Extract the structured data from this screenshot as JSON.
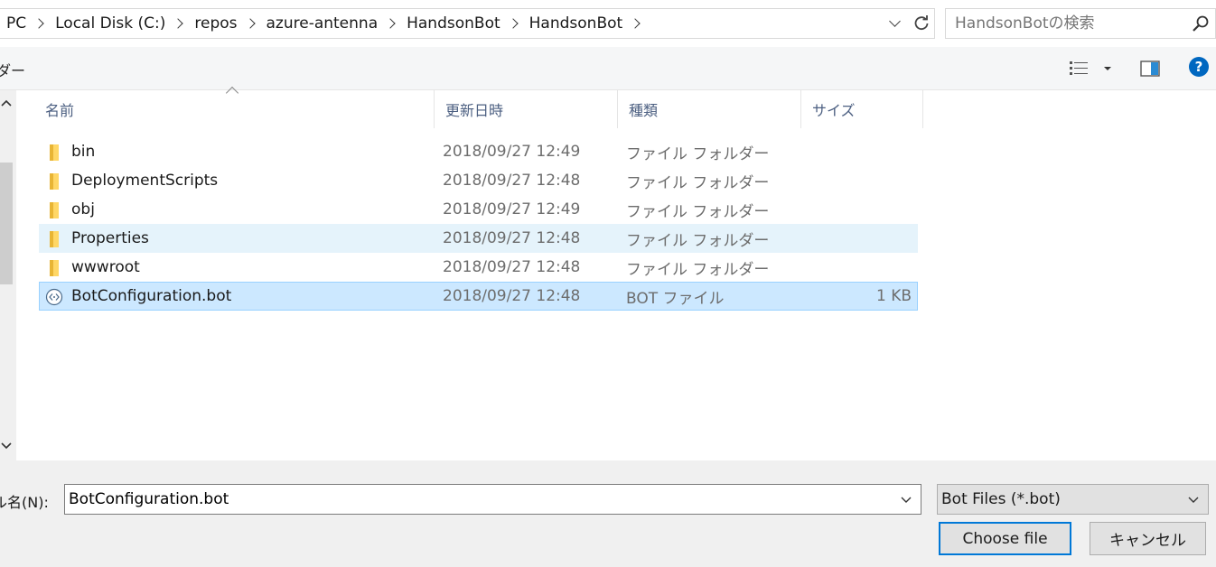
{
  "address": {
    "crumbs": [
      "PC",
      "Local Disk (C:)",
      "repos",
      "azure-antenna",
      "HandsonBot",
      "HandsonBot"
    ]
  },
  "search": {
    "placeholder": "HandsonBotの検索"
  },
  "toolbar": {
    "new_folder_label": "ダー"
  },
  "columns": {
    "name": "名前",
    "date": "更新日時",
    "type": "種類",
    "size": "サイズ"
  },
  "files": [
    {
      "name": "bin",
      "date": "2018/09/27 12:49",
      "type": "ファイル フォルダー",
      "size": "",
      "icon": "folder-icon"
    },
    {
      "name": "DeploymentScripts",
      "date": "2018/09/27 12:48",
      "type": "ファイル フォルダー",
      "size": "",
      "icon": "folder-icon"
    },
    {
      "name": "obj",
      "date": "2018/09/27 12:49",
      "type": "ファイル フォルダー",
      "size": "",
      "icon": "folder-icon"
    },
    {
      "name": "Properties",
      "date": "2018/09/27 12:48",
      "type": "ファイル フォルダー",
      "size": "",
      "icon": "folder-icon"
    },
    {
      "name": "wwwroot",
      "date": "2018/09/27 12:48",
      "type": "ファイル フォルダー",
      "size": "",
      "icon": "folder-icon"
    },
    {
      "name": "BotConfiguration.bot",
      "date": "2018/09/27 12:48",
      "type": "BOT ファイル",
      "size": "1 KB",
      "icon": "bot-file-icon"
    }
  ],
  "filename": {
    "label": "ル名(N):",
    "value": "BotConfiguration.bot"
  },
  "filter": {
    "selected": "Bot Files (*.bot)"
  },
  "buttons": {
    "choose": "Choose file",
    "cancel": "キャンセル"
  },
  "colors": {
    "accent": "#0078d7",
    "selected_row": "#cce8ff",
    "hover_row": "#e5f3fb",
    "folder": "#ffd766",
    "help": "#0067c0"
  }
}
